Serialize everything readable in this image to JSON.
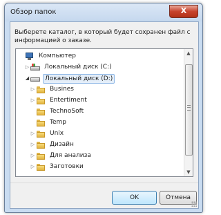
{
  "window": {
    "title": "Обзор папок",
    "close_label": "X"
  },
  "instruction": "Выберете каталог, в который будет сохранен файл с информацией о заказе.",
  "tree": {
    "items": [
      {
        "label": "Компьютер",
        "icon": "computer-icon",
        "level": 0,
        "expander": "none"
      },
      {
        "label": "Локальный диск (C:)",
        "icon": "drive-icon",
        "level": 1,
        "expander": "collapsed"
      },
      {
        "label": "Локальный диск (D:)",
        "icon": "drive-icon",
        "level": 1,
        "expander": "expanded",
        "selected": true
      },
      {
        "label": "Busines",
        "icon": "folder-icon",
        "level": 2,
        "expander": "collapsed"
      },
      {
        "label": "Entertiment",
        "icon": "folder-icon",
        "level": 2,
        "expander": "collapsed"
      },
      {
        "label": "TechnoSoft",
        "icon": "folder-icon",
        "level": 2,
        "expander": "none"
      },
      {
        "label": "Temp",
        "icon": "folder-icon",
        "level": 2,
        "expander": "none"
      },
      {
        "label": "Unix",
        "icon": "folder-icon",
        "level": 2,
        "expander": "collapsed"
      },
      {
        "label": "Дизайн",
        "icon": "folder-icon",
        "level": 2,
        "expander": "collapsed"
      },
      {
        "label": "Для анализа",
        "icon": "folder-icon",
        "level": 2,
        "expander": "collapsed"
      },
      {
        "label": "Заготовки",
        "icon": "folder-icon",
        "level": 2,
        "expander": "collapsed"
      }
    ]
  },
  "buttons": {
    "ok": "OK",
    "cancel": "Отмена"
  },
  "colors": {
    "selection_border": "#8fb8e6",
    "close_button": "#c7432d",
    "folder": "#f8dd7e"
  }
}
